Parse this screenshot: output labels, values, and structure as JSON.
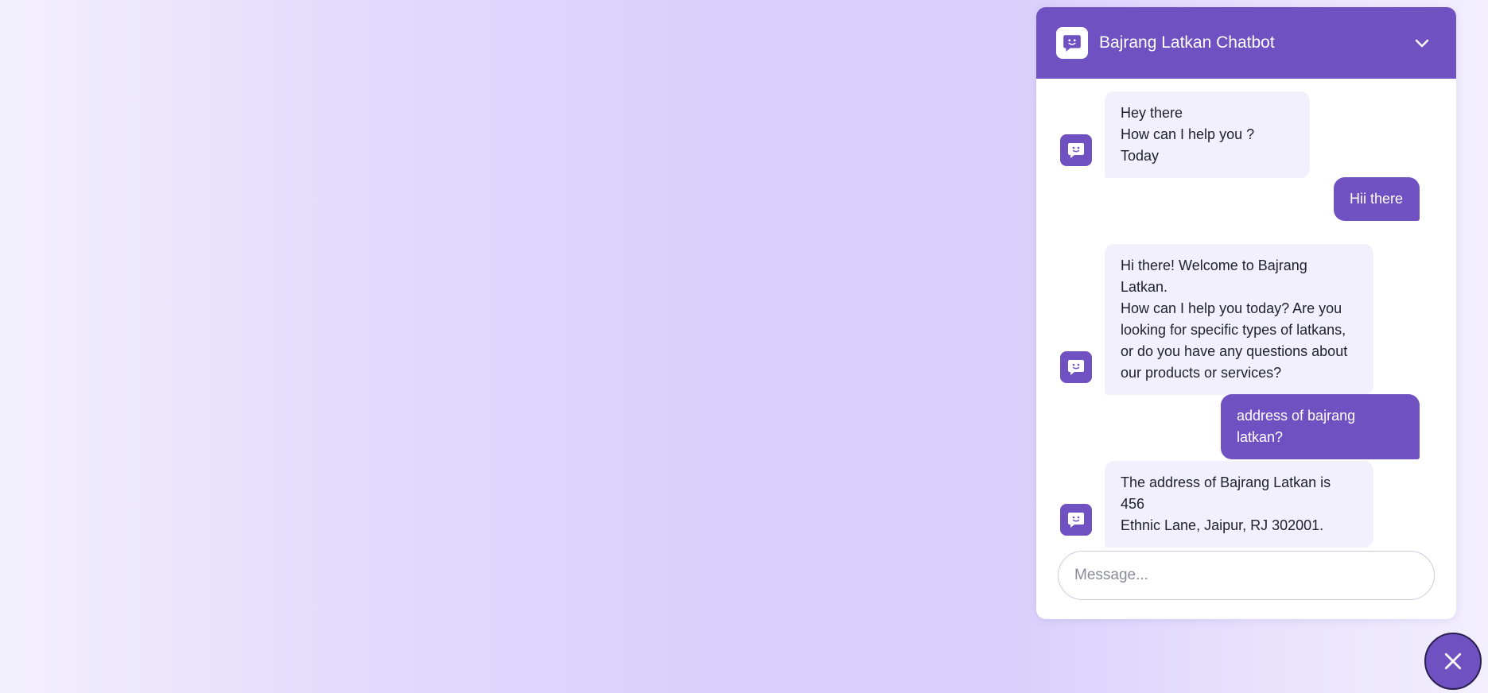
{
  "header": {
    "title": "Bajrang Latkan Chatbot"
  },
  "messages": [
    {
      "role": "bot",
      "text": "Hey there\nHow can I help you ? Today"
    },
    {
      "role": "user",
      "text": "Hii there"
    },
    {
      "role": "bot",
      "text": "Hi there! Welcome to Bajrang Latkan.\nHow can I help you today? Are you\nlooking for specific types of latkans,\nor do you have any questions about\nour products or services?"
    },
    {
      "role": "user",
      "text": "address of bajrang latkan?"
    },
    {
      "role": "bot",
      "text": "The address of Bajrang Latkan is 456\nEthnic Lane, Jaipur, RJ 302001."
    }
  ],
  "composer": {
    "placeholder": "Message...",
    "value": ""
  },
  "icons": {
    "header_logo": "chatbot-icon",
    "collapse": "chevron-down-icon",
    "close": "close-icon"
  },
  "colors": {
    "accent": "#6f51c2",
    "bot_bubble": "#f3f0fd",
    "user_text": "#ffffff"
  }
}
